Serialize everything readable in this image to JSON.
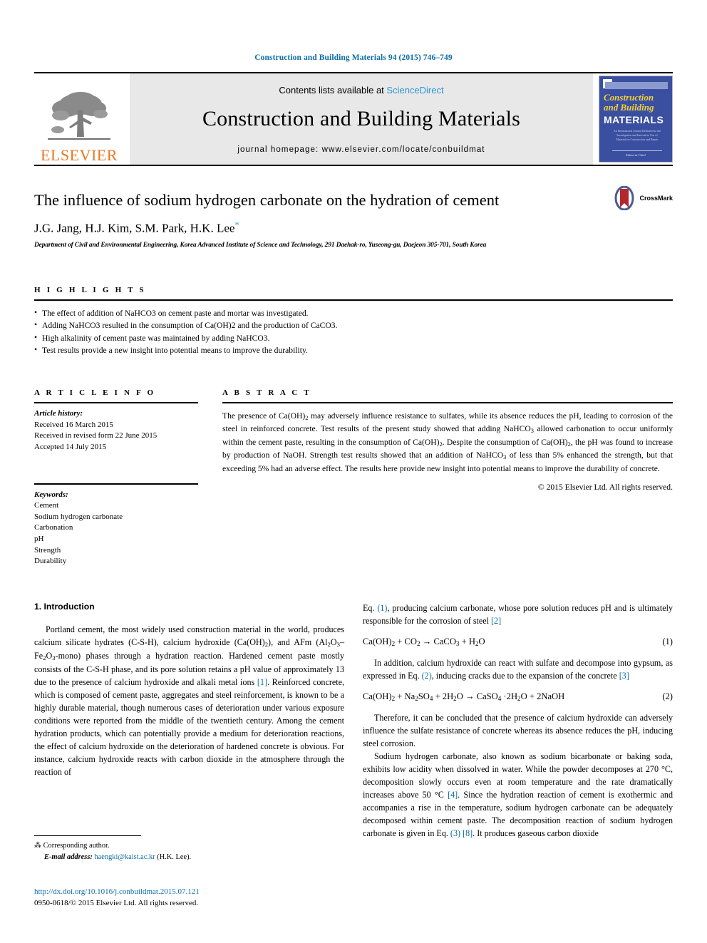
{
  "running_head": "Construction and Building Materials 94 (2015) 746–749",
  "masthead": {
    "contents_prefix": "Contents lists available at ",
    "sciencedirect": "ScienceDirect",
    "journal_name": "Construction and Building Materials",
    "homepage": "journal homepage: www.elsevier.com/locate/conbuildmat",
    "publisher_logo_text": "ELSEVIER",
    "cover": {
      "title_line1": "Construction",
      "title_line2": "and Building",
      "title_line3": "MATERIALS",
      "subtitle": "An International Journal Dedicated to the Investigation and Innovative Use of Materials in Construction and Repair",
      "footer": "Editor-in-Chief"
    }
  },
  "article": {
    "title": "The influence of sodium hydrogen carbonate on the hydration of cement",
    "authors": "J.G. Jang, H.J. Kim, S.M. Park, H.K. Lee",
    "author_star": "*",
    "affiliation": "Department of Civil and Environmental Engineering, Korea Advanced Institute of Science and Technology, 291 Daehak-ro, Yuseong-gu, Daejeon 305-701, South Korea",
    "crossmark_label": "CrossMark"
  },
  "highlights": {
    "heading": "H I G H L I G H T S",
    "items": [
      "The effect of addition of NaHCO3 on cement paste and mortar was investigated.",
      "Adding NaHCO3 resulted in the consumption of Ca(OH)2 and the production of CaCO3.",
      "High alkalinity of cement paste was maintained by adding NaHCO3.",
      "Test results provide a new insight into potential means to improve the durability."
    ]
  },
  "article_info": {
    "heading": "A R T I C L E    I N F O",
    "history_label": "Article history:",
    "history": [
      "Received 16 March 2015",
      "Received in revised form 22 June 2015",
      "Accepted 14 July 2015"
    ],
    "keywords_label": "Keywords:",
    "keywords": [
      "Cement",
      "Sodium hydrogen carbonate",
      "Carbonation",
      "pH",
      "Strength",
      "Durability"
    ]
  },
  "abstract": {
    "heading": "A B S T R A C T",
    "text": "The presence of Ca(OH)2 may adversely influence resistance to sulfates, while its absence reduces the pH, leading to corrosion of the steel in reinforced concrete. Test results of the present study showed that adding NaHCO3 allowed carbonation to occur uniformly within the cement paste, resulting in the consumption of Ca(OH)2. Despite the consumption of Ca(OH)2, the pH was found to increase by production of NaOH. Strength test results showed that an addition of NaHCO3 of less than 5% enhanced the strength, but that exceeding 5% had an adverse effect. The results here provide new insight into potential means to improve the durability of concrete.",
    "copyright": "© 2015 Elsevier Ltd. All rights reserved."
  },
  "body": {
    "section_number_title": "1. Introduction",
    "left_paragraph": "Portland cement, the most widely used construction material in the world, produces calcium silicate hydrates (C-S-H), calcium hydroxide (Ca(OH)2), and AFm (Al2O3–Fe2O3-mono) phases through a hydration reaction. Hardened cement paste mostly consists of the C-S-H phase, and its pore solution retains a pH value of approximately 13 due to the presence of calcium hydroxide and alkali metal ions [1]. Reinforced concrete, which is composed of cement paste, aggregates and steel reinforcement, is known to be a highly durable material, though numerous cases of deterioration under various exposure conditions were reported from the middle of the twentieth century. Among the cement hydration products, which can potentially provide a medium for deterioration reactions, the effect of calcium hydroxide on the deterioration of hardened concrete is obvious. For instance, calcium hydroxide reacts with carbon dioxide in the atmosphere through the reaction of",
    "right_lead": "Eq. (1), producing calcium carbonate, whose pore solution reduces pH and is ultimately responsible for the corrosion of steel [2]",
    "equation_1_num": "(1)",
    "equation_2_num": "(2)",
    "right_p2": "In addition, calcium hydroxide can react with sulfate and decompose into gypsum, as expressed in Eq. (2), inducing cracks due to the expansion of the concrete [3]",
    "right_p3": "Therefore, it can be concluded that the presence of calcium hydroxide can adversely influence the sulfate resistance of concrete whereas its absence reduces the pH, inducing steel corrosion.",
    "right_p4": "Sodium hydrogen carbonate, also known as sodium bicarbonate or baking soda, exhibits low acidity when dissolved in water. While the powder decomposes at 270 °C, decomposition slowly occurs even at room temperature and the rate dramatically increases above 50 °C [4]. Since the hydration reaction of cement is exothermic and accompanies a rise in the temperature, sodium hydrogen carbonate can be adequately decomposed within cement paste. The decomposition reaction of sodium hydrogen carbonate is given in Eq. (3) [8]. It produces gaseous carbon dioxide"
  },
  "footnotes": {
    "corresponding_star": "⁂",
    "corresponding": "Corresponding author.",
    "email_label": "E-mail address:",
    "email": "haengki@kaist.ac.kr",
    "email_suffix": "(H.K. Lee).",
    "doi": "http://dx.doi.org/10.1016/j.conbuildmat.2015.07.121",
    "issn_line": "0950-0618/© 2015 Elsevier Ltd. All rights reserved."
  },
  "colors": {
    "link_blue": "#0d6ca5",
    "sciencedirect_blue": "#2b96d4",
    "elsevier_orange": "#e87722",
    "cover_blue": "#3a4fa0",
    "cover_yellow": "#f2d13b"
  }
}
